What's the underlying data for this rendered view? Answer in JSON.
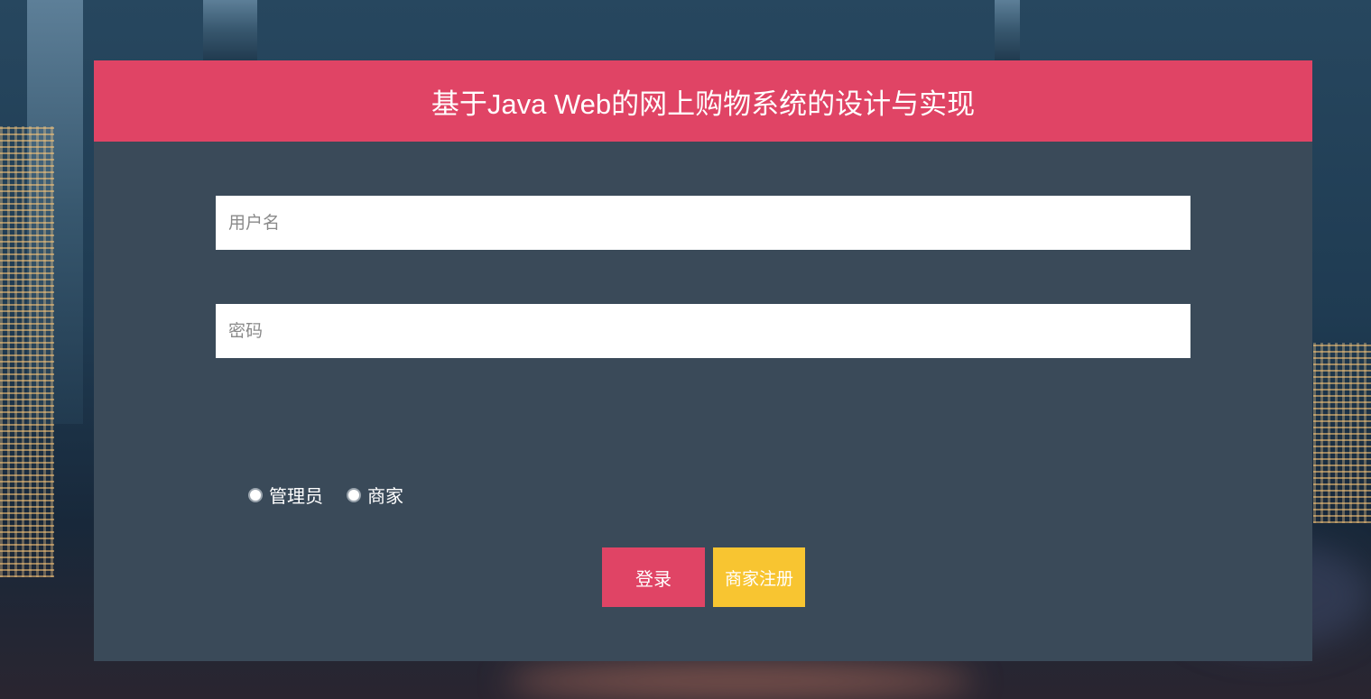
{
  "header": {
    "title": "基于Java Web的网上购物系统的设计与实现"
  },
  "form": {
    "username_placeholder": "用户名",
    "password_placeholder": "密码",
    "roles": [
      {
        "label": "管理员"
      },
      {
        "label": "商家"
      }
    ],
    "login_label": "登录",
    "register_label": "商家注册"
  },
  "colors": {
    "header": "#e04465",
    "panel": "#3a4a59",
    "login_button": "#e04465",
    "register_button": "#f8c531"
  }
}
